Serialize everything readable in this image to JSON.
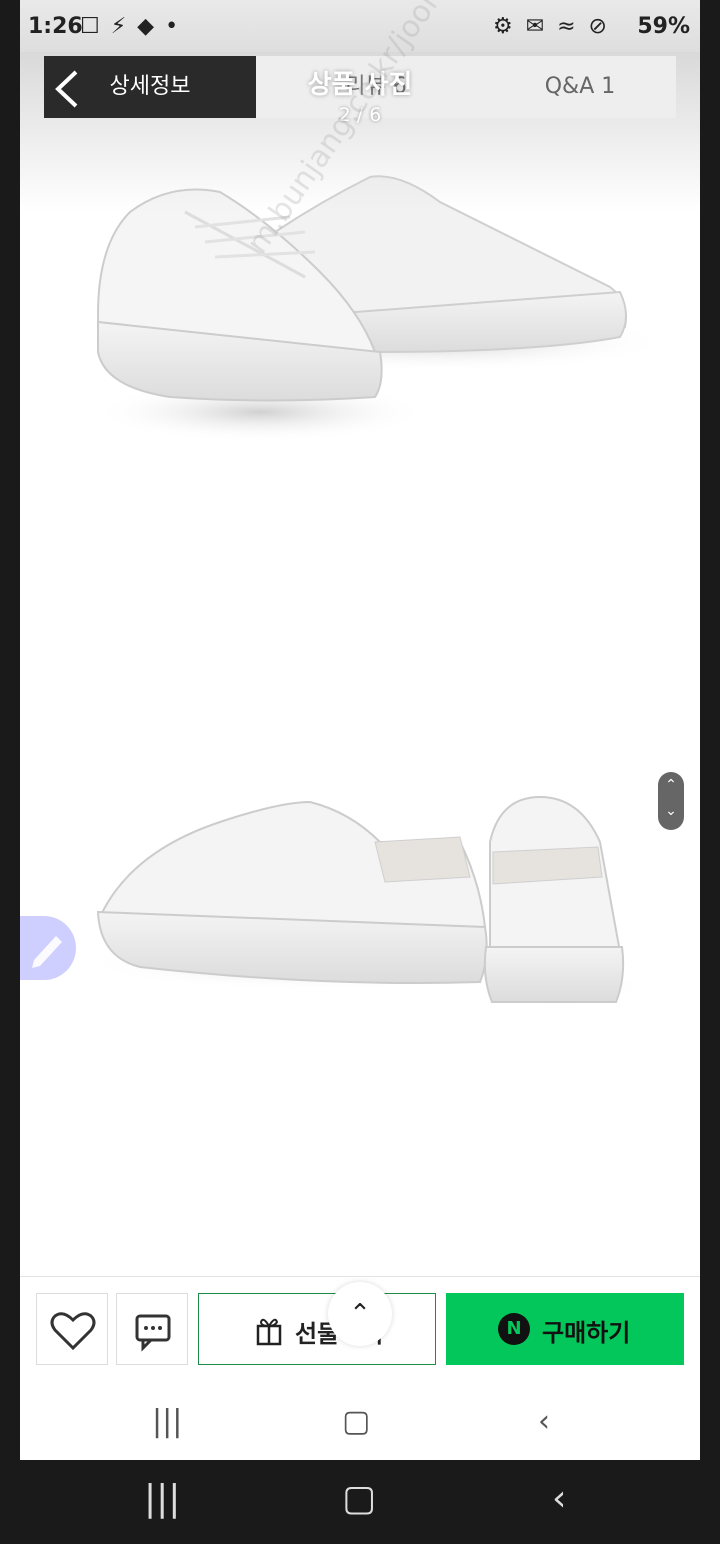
{
  "status_bar": {
    "time": "1:26",
    "battery": "59%",
    "notification_icons": "☐ ⚡ ◆ •",
    "system_icons": "⚙ ✉ ≈ ⊘"
  },
  "tabs": {
    "detail": "상세정보",
    "review": "리뷰 6",
    "qna": "Q&A 1"
  },
  "viewer": {
    "title": "상품 사진",
    "counter": "2 / 6"
  },
  "watermark": "m.bunjang.co.kr/joonggonara",
  "scroll_handle": {
    "up": "⌃",
    "down": "⌄"
  },
  "bottom_bar": {
    "gift_label": "선물하기",
    "buy_label": "구매하기",
    "npay_letter": "N"
  },
  "scroll_top_glyph": "⌃",
  "nav": {
    "recents": "|||",
    "home": "▢",
    "back": "‹"
  }
}
